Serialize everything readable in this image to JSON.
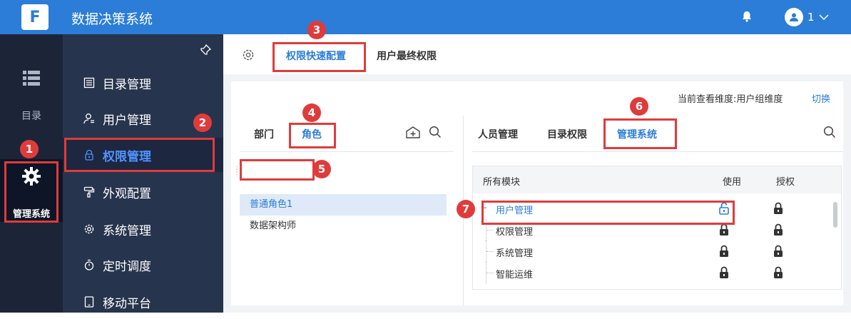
{
  "topbar": {
    "title": "数据决策系统",
    "user_name": "1",
    "logo_text": "F"
  },
  "leftbar": {
    "directory_label": "目录",
    "manage_label": "管理系统"
  },
  "nav": {
    "items": [
      {
        "label": "目录管理",
        "icon": "list-icon"
      },
      {
        "label": "用户管理",
        "icon": "user-icon"
      },
      {
        "label": "权限管理",
        "icon": "lock-icon"
      },
      {
        "label": "外观配置",
        "icon": "paint-roller-icon"
      },
      {
        "label": "系统管理",
        "icon": "gear-icon"
      },
      {
        "label": "定时调度",
        "icon": "timer-icon"
      },
      {
        "label": "移动平台",
        "icon": "tablet-icon"
      }
    ]
  },
  "tabs": {
    "quick_config": "权限快速配置",
    "final_perm": "用户最终权限"
  },
  "dimension": {
    "info": "当前查看维度:用户组维度",
    "switch": "切换"
  },
  "left_panel": {
    "tab_dept": "部门",
    "tab_role": "角色",
    "roles": [
      "普通角色1",
      "数据架构师"
    ]
  },
  "right_panel": {
    "tabs": [
      "人员管理",
      "目录权限",
      "管理系统"
    ],
    "headers": {
      "module": "所有模块",
      "use": "使用",
      "grant": "授权"
    },
    "rows": [
      {
        "name": "用户管理",
        "use": "unlocked",
        "grant": "locked"
      },
      {
        "name": "权限管理",
        "use": "locked",
        "grant": "locked"
      },
      {
        "name": "系统管理",
        "use": "locked",
        "grant": "locked"
      },
      {
        "name": "智能运维",
        "use": "locked",
        "grant": "locked"
      }
    ]
  },
  "markers": [
    "1",
    "2",
    "3",
    "4",
    "5",
    "6",
    "7"
  ],
  "colors": {
    "brand": "#2b7dd8",
    "marker": "#e03b3b",
    "sidebar": "#27344d"
  }
}
